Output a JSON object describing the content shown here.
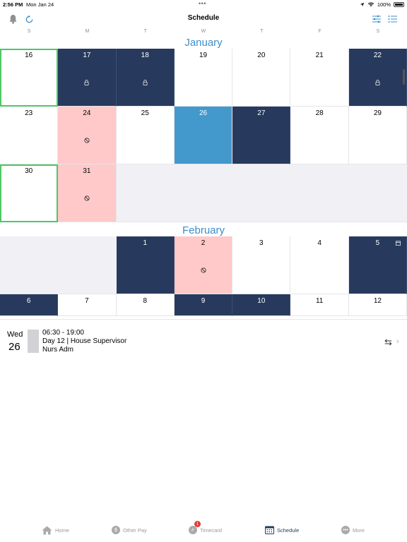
{
  "status": {
    "time": "2:56 PM",
    "date": "Mon Jan 24",
    "battery": "100%"
  },
  "nav": {
    "title": "Schedule"
  },
  "weekdays": [
    "S",
    "M",
    "T",
    "W",
    "T",
    "F",
    "S"
  ],
  "calendar": {
    "january_label": "January",
    "february_label": "February",
    "jan_days": [
      "16",
      "17",
      "18",
      "19",
      "20",
      "21",
      "22",
      "23",
      "24",
      "25",
      "26",
      "27",
      "28",
      "29",
      "30",
      "31"
    ],
    "feb_days": [
      "1",
      "2",
      "3",
      "4",
      "5",
      "6",
      "7",
      "8",
      "9",
      "10",
      "11",
      "12"
    ]
  },
  "detail": {
    "dow": "Wed",
    "day": "26",
    "time_range": "06:30 - 19:00",
    "shift": "Day 12 | House Supervisor",
    "unit": "Nurs Adm"
  },
  "tabs": {
    "home": "Home",
    "other_pay": "Other Pay",
    "timecard": "Timecard",
    "timecard_badge": "1",
    "schedule": "Schedule",
    "more": "More"
  },
  "colors": {
    "accent": "#3d8ec9",
    "scheduled": "#273a5d",
    "selected": "#4398cc",
    "unavailable": "#ffc9c9",
    "today_outline": "#4cc765"
  }
}
